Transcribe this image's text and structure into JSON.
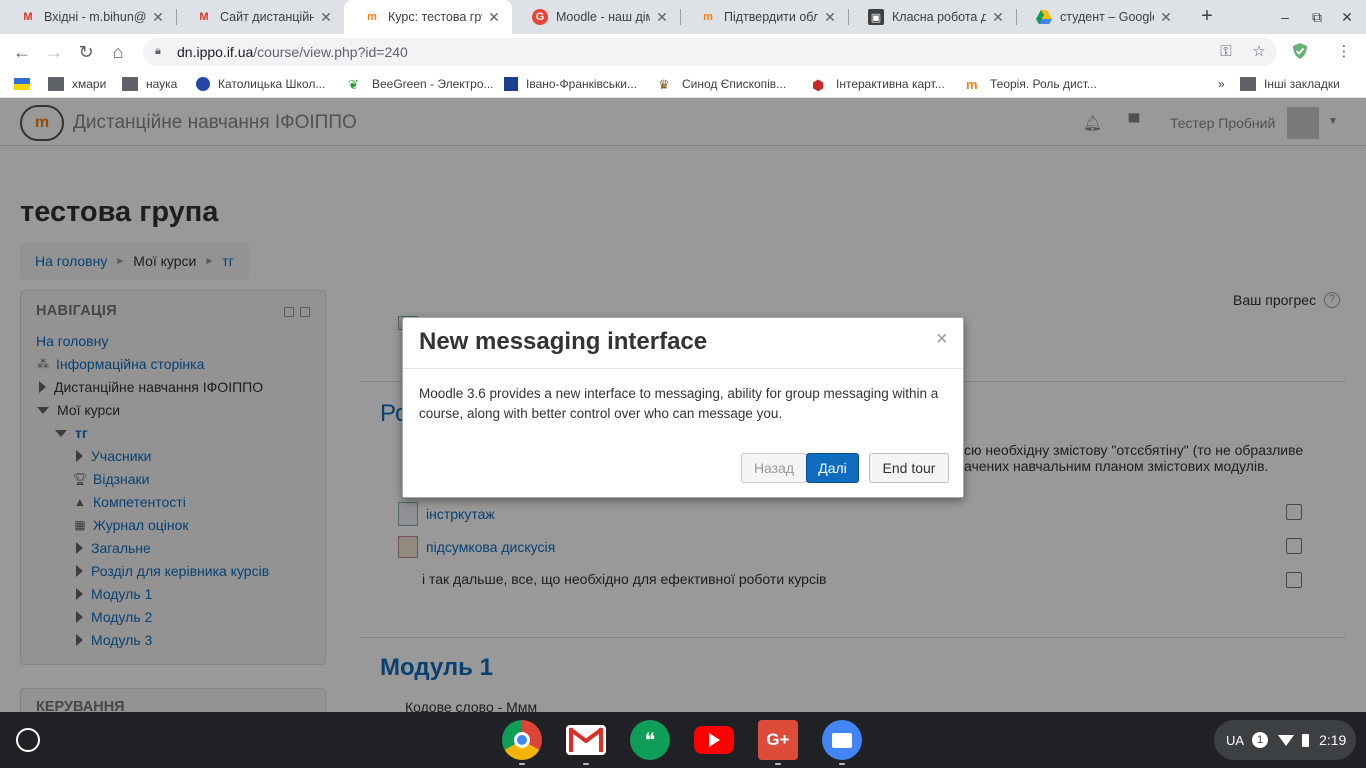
{
  "browser": {
    "tabs": [
      {
        "title": "Вхідні - m.bihun@if",
        "favicon": "gmail-icon",
        "active": false
      },
      {
        "title": "Сайт дистанційно",
        "favicon": "gmail-icon",
        "active": false
      },
      {
        "title": "Курс: тестова груп",
        "favicon": "moodle-icon",
        "active": true
      },
      {
        "title": "Moodle - наш дім (",
        "favicon": "google-icon",
        "active": false
      },
      {
        "title": "Підтвердити облік",
        "favicon": "moodle-icon",
        "active": false
      },
      {
        "title": "Класна робота дл",
        "favicon": "classroom-icon",
        "active": false
      },
      {
        "title": "студент – Google Д",
        "favicon": "drive-icon",
        "active": false
      }
    ],
    "url": {
      "host": "dn.ippo.if.ua",
      "path": "/course/view.php?id=240"
    },
    "bookmarks": [
      {
        "label": "",
        "icon": "flag-icon"
      },
      {
        "label": "хмари",
        "icon": "folder-icon"
      },
      {
        "label": "наука",
        "icon": "folder-icon"
      },
      {
        "label": "Католицька Школ...",
        "icon": "school-icon"
      },
      {
        "label": "BeeGreen - Электро...",
        "icon": "beegreen-icon"
      },
      {
        "label": "Івано-Франківськи...",
        "icon": "calendar-icon"
      },
      {
        "label": "Синод Єпископів...",
        "icon": "crest-icon"
      },
      {
        "label": "Інтерактивна карт...",
        "icon": "map-pin-icon"
      },
      {
        "label": "Теорія. Роль дист...",
        "icon": "moodle-icon"
      }
    ],
    "bookmarks_more": "»",
    "other_bookmarks": "Інші закладки"
  },
  "moodle": {
    "site_name": "Дистанційне навчання ІФОІППО",
    "user_name": "Тестер Пробний",
    "course_title": "тестова група",
    "breadcrumb": [
      "На головну",
      "Мої курси",
      "тг"
    ],
    "navigation": {
      "heading": "НАВІГАЦІЯ",
      "items": [
        {
          "label": "На головну"
        },
        {
          "label": "Інформаційна сторінка"
        },
        {
          "label": "Дистанційне навчання ІФОІППО"
        },
        {
          "label": "Мої курси"
        },
        {
          "label": "тг"
        },
        {
          "label": "Учасники"
        },
        {
          "label": "Відзнаки"
        },
        {
          "label": "Компетентості"
        },
        {
          "label": "Журнал оцінок"
        },
        {
          "label": "Загальне"
        },
        {
          "label": "Розділ для керівника курсів"
        },
        {
          "label": "Модуль 1"
        },
        {
          "label": "Модуль 2"
        },
        {
          "label": "Модуль 3"
        }
      ]
    },
    "admin_heading": "КЕРУВАННЯ",
    "progress_label": "Ваш прогрес",
    "section1": {
      "title_partial": "Ро",
      "summary_line1": "сю необхідну змістову \"отсєбятіну\" (то не образливе",
      "summary_line2": "ачених навчальним планом змістових модулів.",
      "activities": [
        {
          "label": "інстркутаж",
          "link": true
        },
        {
          "label": "підсумкова дискусія",
          "link": true
        },
        {
          "label": "і так дальше, все, що необхідно для ефективної роботи курсів",
          "link": false
        }
      ]
    },
    "section2": {
      "title": "Модуль 1",
      "summary": "Кодове слово - Ммм"
    }
  },
  "tour": {
    "title": "New messaging interface",
    "close": "×",
    "body": "Moodle 3.6 provides a new interface to messaging, ability for group messaging within a course, along with better control over who can message you.",
    "buttons": {
      "back": "Назад",
      "next": "Далі",
      "end": "End tour"
    }
  },
  "shelf": {
    "apps": [
      "chrome-icon",
      "gmail-icon",
      "hangouts-icon",
      "youtube-icon",
      "google-plus-icon",
      "files-icon"
    ],
    "lang": "UA",
    "notifications": "1",
    "time": "2:19"
  },
  "colors": {
    "moodle_link": "#0f6cbf",
    "tour_primary": "#0f6cbf",
    "shelf_bg": "#202124",
    "moodle_orange": "#f98012"
  }
}
